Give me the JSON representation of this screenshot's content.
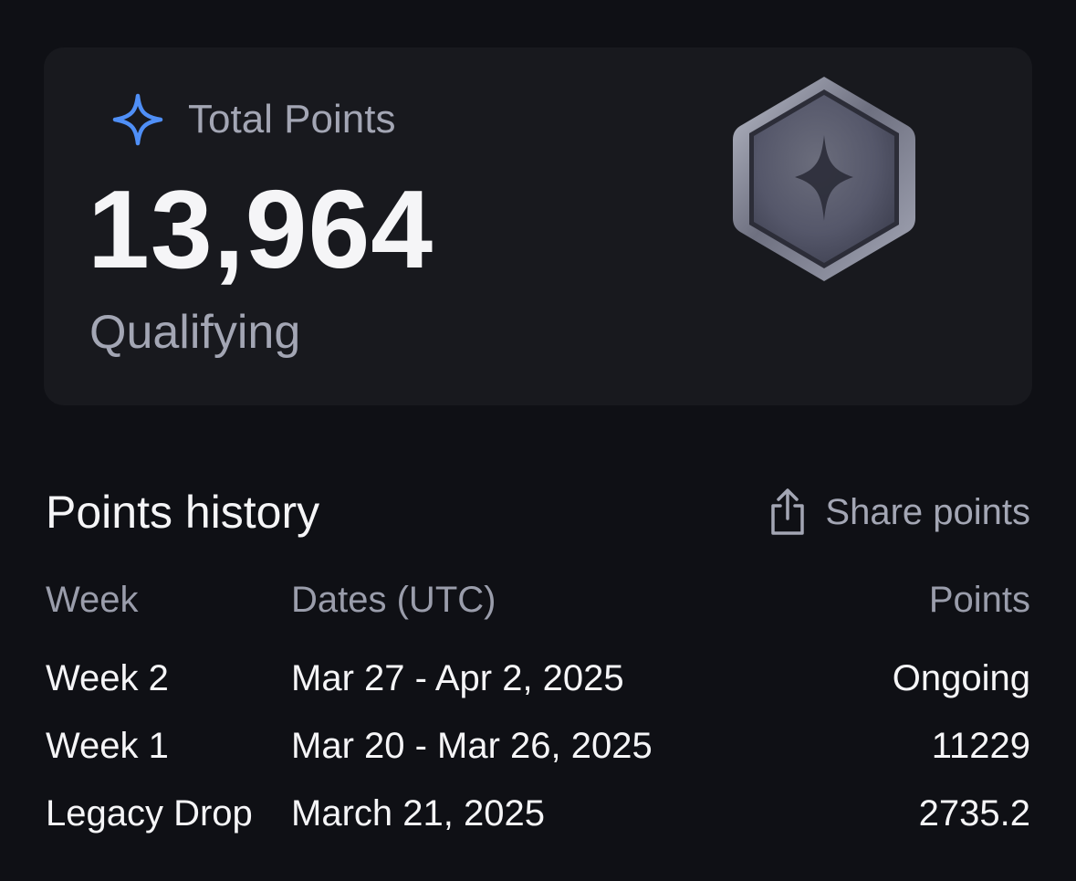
{
  "summary": {
    "label": "Total Points",
    "total": "13,964",
    "status": "Qualifying",
    "accent_color": "#4f8ff7",
    "badge_icon": "hexagon-star-badge"
  },
  "history": {
    "title": "Points history",
    "share_label": "Share points",
    "share_icon": "share-icon",
    "columns": {
      "week": "Week",
      "dates": "Dates (UTC)",
      "points": "Points"
    },
    "rows": [
      {
        "week": "Week 2",
        "dates": "Mar 27 - Apr 2, 2025",
        "points": "Ongoing"
      },
      {
        "week": "Week 1",
        "dates": "Mar 20 - Mar 26, 2025",
        "points": "11229"
      },
      {
        "week": "Legacy Drop",
        "dates": "March 21, 2025",
        "points": "2735.2"
      }
    ]
  }
}
